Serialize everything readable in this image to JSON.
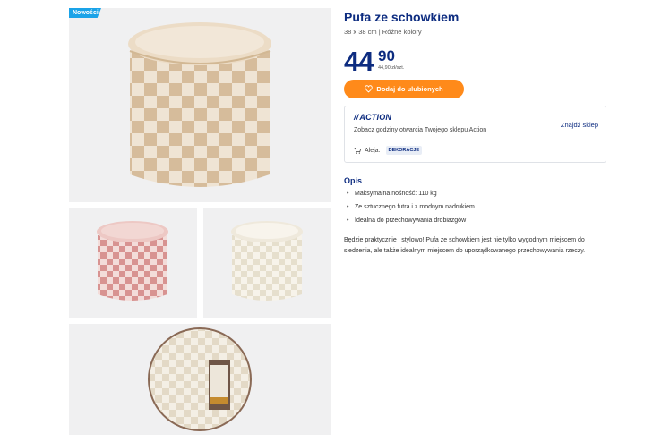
{
  "badge": "Nowości",
  "product": {
    "title": "Pufa ze schowkiem",
    "subtitle": "38 x 38 cm | Różne kolory",
    "price_int": "44",
    "price_dec": "90",
    "price_unit": "44,90 zł/szt."
  },
  "favorite_button": {
    "label": "Dodaj do ulubionych",
    "icon": "heart-icon"
  },
  "store": {
    "logo": "ACTION",
    "hours_text": "Zobacz godziny otwarcia Twojego sklepu Action",
    "find_store_label": "Znajdź sklep",
    "aisle_label": "Aleja:",
    "aisle_tag": "DEKORACJE",
    "icon": "cart-icon"
  },
  "description": {
    "title": "Opis",
    "bullets": [
      "Maksymalna nośność: 110 kg",
      "Ze sztucznego futra i z modnym nadrukiem",
      "Idealna do przechowywania drobiazgów"
    ],
    "text": "Będzie praktycznie i stylowo! Pufa ze schowkiem jest nie tylko wygodnym miejscem do siedzenia, ale także idealnym miejscem do uporządkowanego przechowywania rzeczy."
  },
  "colors": {
    "brand_blue": "#0d2c80",
    "accent_orange": "#ff8a1a",
    "badge_blue": "#1aa3e8",
    "beige": "#dcc5a8",
    "cream": "#f3eee3",
    "pink": "#e2a6a4"
  }
}
